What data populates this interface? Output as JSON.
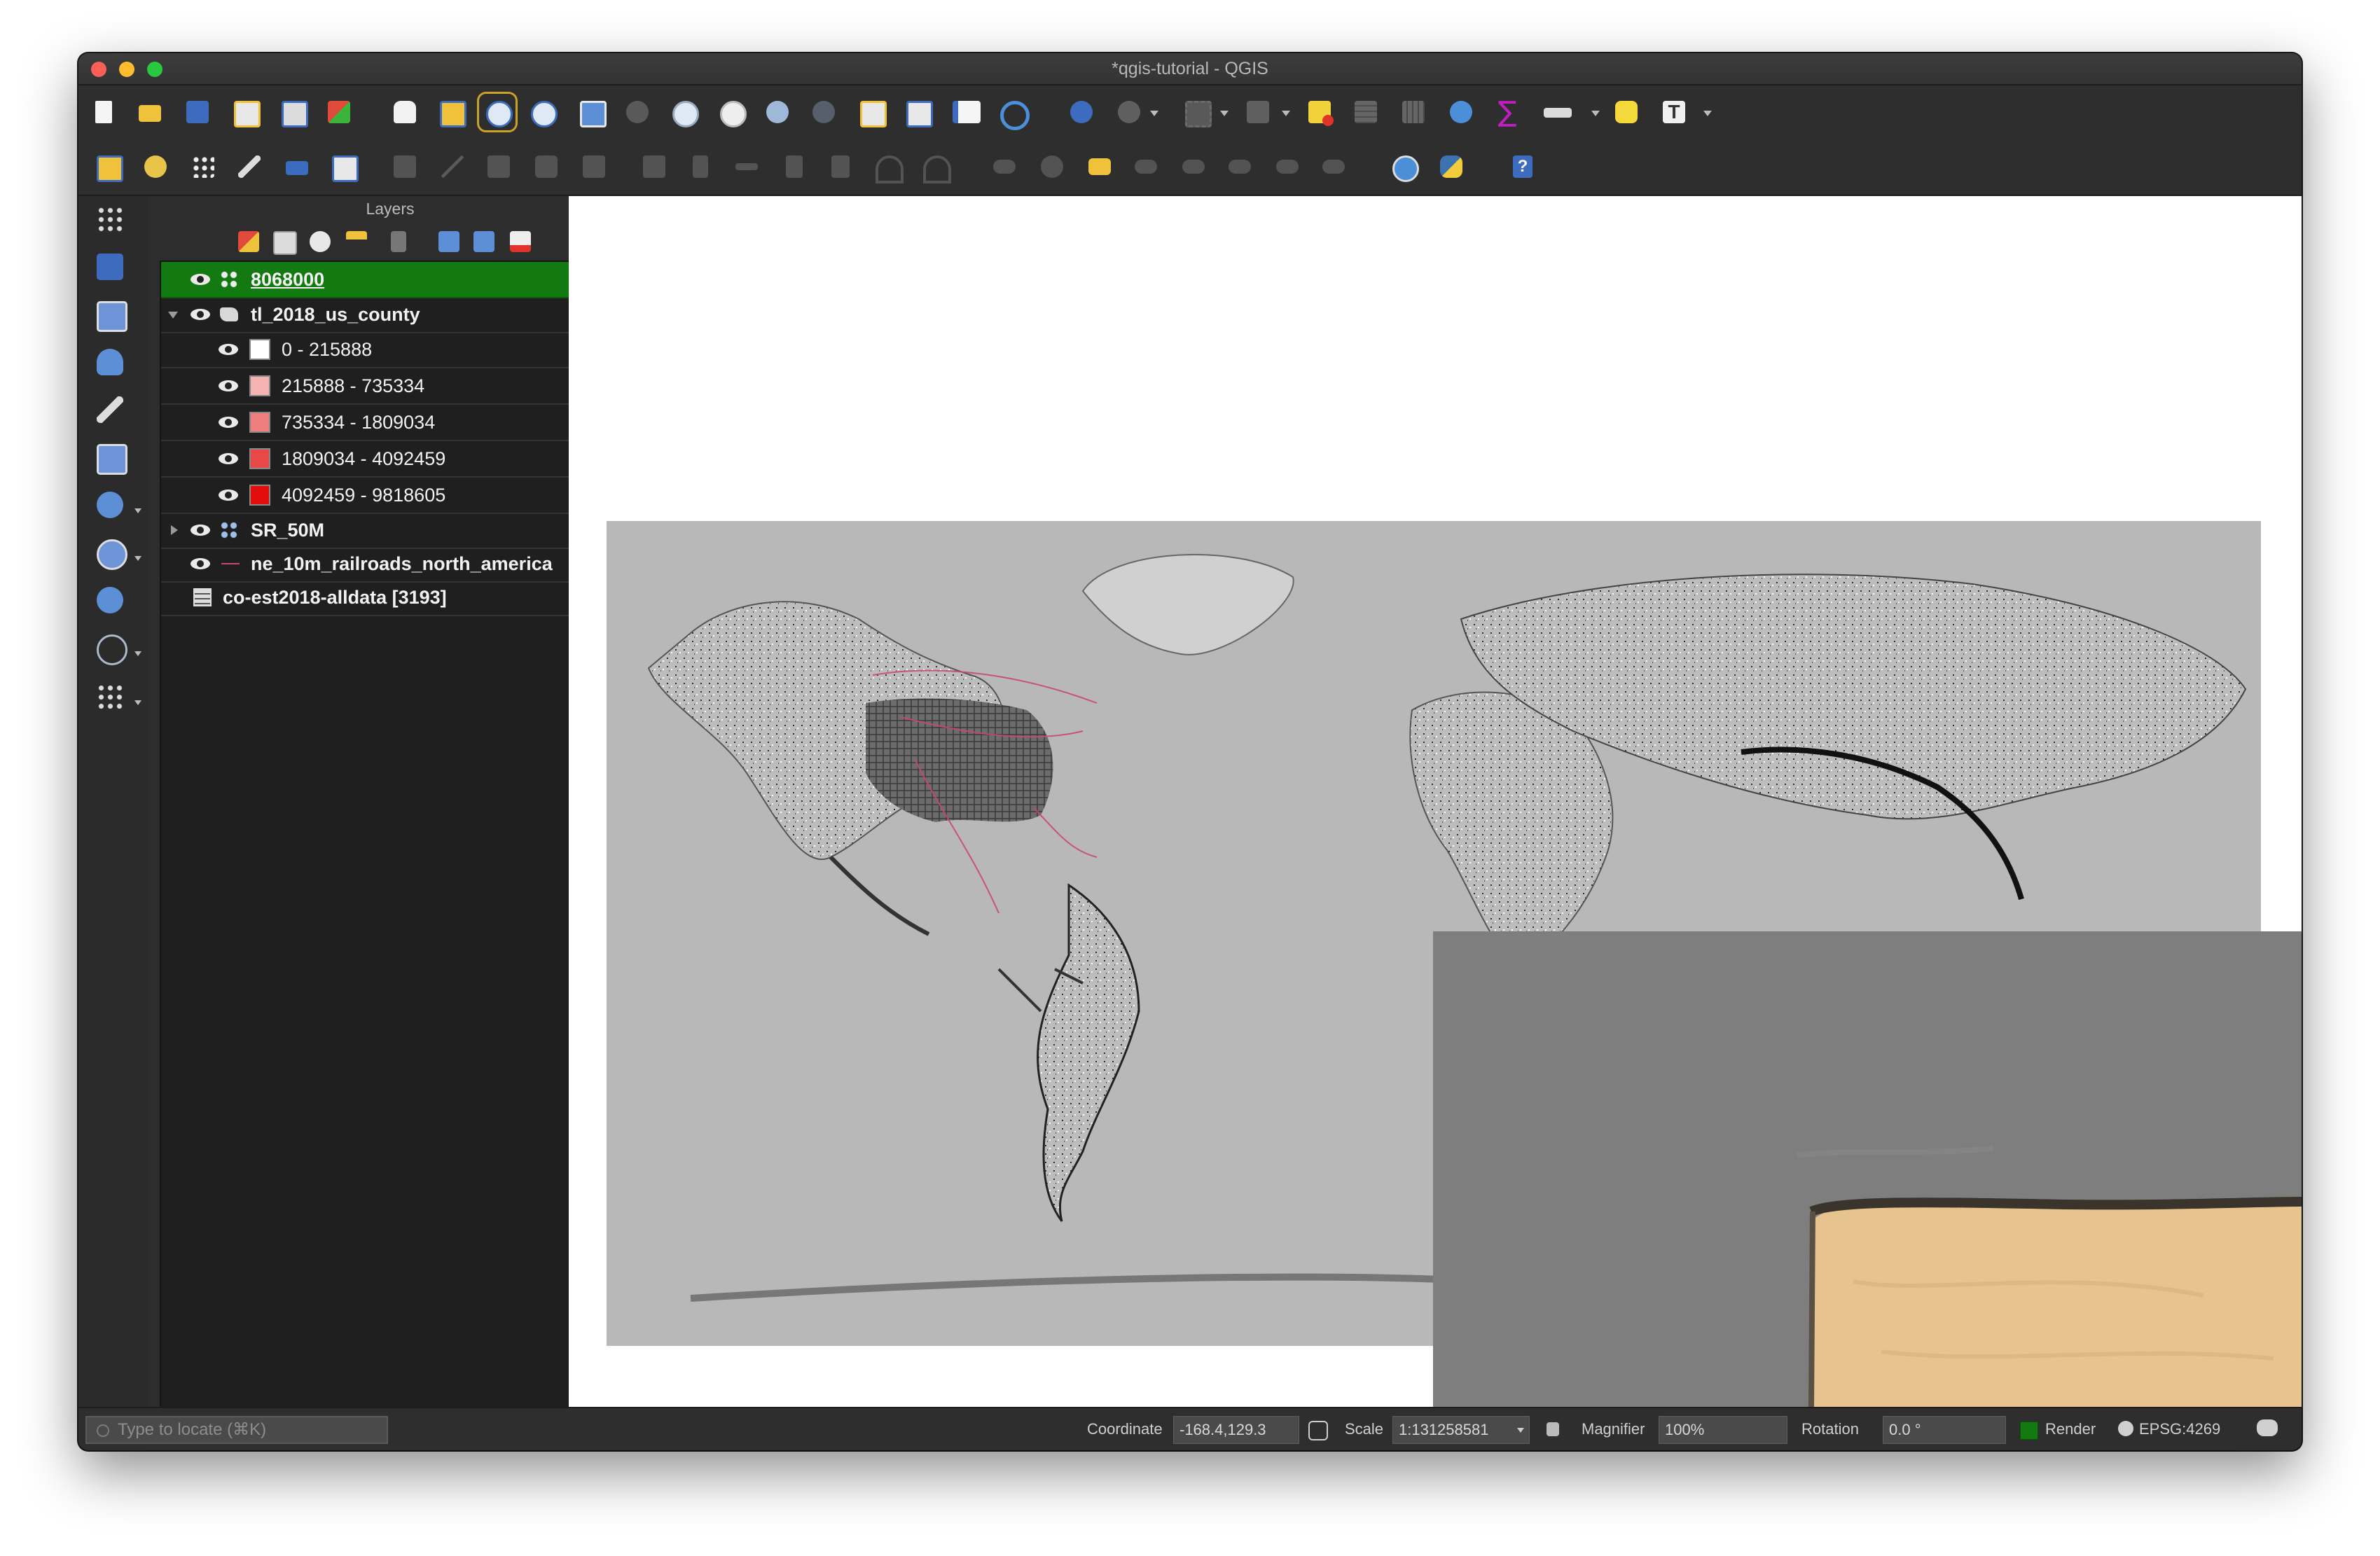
{
  "window": {
    "title": "*qgis-tutorial - QGIS"
  },
  "colors": {
    "selection": "#137a11",
    "background": "#2a2a2a",
    "tree": "#1f1f1f",
    "map_gray": "#b8b8b8",
    "inset_gray": "#7e7e7e",
    "railroads": "#c9467a",
    "parchment": "#e7c48e"
  },
  "toolbar_primary_icons": [
    "new-project-icon",
    "open-project-icon",
    "save-project-icon",
    "new-print-layout-icon",
    "layout-manager-icon",
    "style-manager-icon",
    "pan-icon",
    "pan-to-selection-icon",
    "zoom-in-icon",
    "zoom-out-icon",
    "zoom-full-icon",
    "zoom-to-selection-icon",
    "zoom-to-layer-icon",
    "zoom-native-icon",
    "zoom-last-icon",
    "zoom-next-icon",
    "new-map-view-icon",
    "new-3d-map-view-icon",
    "new-bookmark-icon",
    "refresh-icon",
    "identify-icon",
    "run-action-icon",
    "select-features-icon",
    "select-by-location-icon",
    "deselect-icon",
    "attribute-table-icon",
    "field-calculator-icon",
    "processing-toolbox-icon",
    "statistical-summary-icon",
    "measure-icon",
    "map-tips-icon",
    "text-annotation-icon"
  ],
  "toolbar_secondary_icons": [
    "data-source-manager-icon",
    "add-vector-layer-icon",
    "digitize-icon",
    "edit-pencil-icon",
    "save-edits-icon",
    "add-feature-icon",
    "vertex-tool-icon",
    "delete-selected-icon",
    "cut-icon",
    "copy-icon",
    "paste-icon",
    "undo-icon",
    "redo-icon",
    "label-icon",
    "pin-labels-icon",
    "layer-labeling-icon",
    "show-hide-labels-icon",
    "move-label-icon",
    "rotate-label-icon",
    "change-label-icon",
    "plugin-globe-icon",
    "python-console-icon",
    "help-icon"
  ],
  "left_toolbar_icons": [
    "add-delimited-text-icon",
    "add-raster-icon",
    "add-mesh-icon",
    "add-spatialite-icon",
    "add-virtual-layer-icon",
    "add-geopackage-icon",
    "add-postgis-icon",
    "add-wms-icon",
    "add-wfs-icon",
    "add-wcs-icon",
    "new-temporary-layer-icon"
  ],
  "layers_panel": {
    "title": "Layers",
    "tools": [
      "style-icon",
      "add-group-icon",
      "manage-visibility-icon",
      "filter-legend-icon",
      "filter-map-icon",
      "expand-all-icon",
      "collapse-all-icon",
      "remove-layer-icon"
    ],
    "items": [
      {
        "label": "8068000",
        "selected": true
      },
      {
        "label": "tl_2018_us_county",
        "expanded": true
      },
      {
        "label": "0 - 215888",
        "color": "#ffffff"
      },
      {
        "label": "215888 - 735334",
        "color": "#f4b3b3"
      },
      {
        "label": "735334 - 1809034",
        "color": "#ef7f7f"
      },
      {
        "label": "1809034 - 4092459",
        "color": "#e94848"
      },
      {
        "label": "4092459 - 9818605",
        "color": "#e40d0d"
      },
      {
        "label": "SR_50M",
        "expanded": false
      },
      {
        "label": "ne_10m_railroads_north_america"
      },
      {
        "label": "co-est2018-alldata [3193]"
      }
    ]
  },
  "statusbar": {
    "locator_placeholder": "Type to locate (⌘K)",
    "coordinate_label": "Coordinate",
    "coordinate_value": "-168.4,129.3",
    "scale_label": "Scale",
    "scale_value": "1:131258581",
    "magnifier_label": "Magnifier",
    "magnifier_value": "100%",
    "rotation_label": "Rotation",
    "rotation_value": "0.0 °",
    "render_label": "Render",
    "crs_label": "EPSG:4269"
  }
}
